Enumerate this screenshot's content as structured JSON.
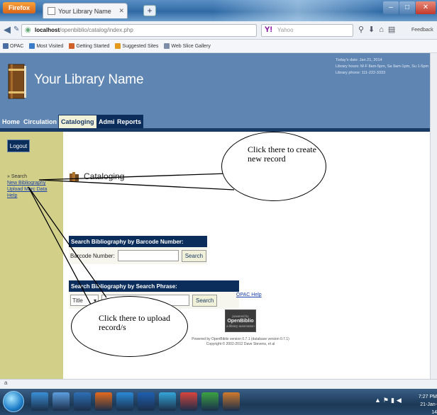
{
  "browser": {
    "menu_button": "Firefox",
    "tab_title": "Your Library Name",
    "url_host": "localhost",
    "url_path": "/openbiblio/catalog/index.php",
    "search_engine": "Yahoo",
    "feedback": "Feedback",
    "bookmarks": [
      {
        "label": "OPAC",
        "color": "#4a6fa5"
      },
      {
        "label": "Most Visited",
        "color": "#3b7cc9"
      },
      {
        "label": "Getting Started",
        "color": "#d0602a"
      },
      {
        "label": "Suggested Sites",
        "color": "#e39a1f"
      },
      {
        "label": "Web Slice Gallery",
        "color": "#7d8fa8"
      }
    ]
  },
  "header": {
    "library_name": "Your Library Name",
    "info_line1": "Today's date: Jan 21, 2014",
    "info_line2": "Library hours: M-F 8am-5pm, Sa 9am-1pm, Su 1-5pm",
    "info_line3": "Library phone: 111-222-3333"
  },
  "nav": {
    "home": "Home",
    "circulation": "Circulation",
    "cataloging": "Cataloging",
    "admin": "Admin",
    "reports": "Reports"
  },
  "sidebar": {
    "logout": "Logout",
    "search_label": "» Search",
    "new_bibliography": "New Bibliography",
    "upload_marc": "Upload Marc Data",
    "help": "Help"
  },
  "main": {
    "page_title": "Cataloging",
    "barcode_box_title": "Search Bibliography by Barcode Number:",
    "barcode_label": "Barcode Number:",
    "barcode_value": "",
    "phrase_box_title": "Search Bibliography by Search Phrase:",
    "phrase_select": "Title",
    "phrase_value": "",
    "search_button": "Search",
    "help_link": "OPAC Help",
    "powered_top": "powered by",
    "powered_brand": "OpenBiblio",
    "powered_bottom": "a library automation",
    "footer_line1": "Powered by OpenBiblio version 0.7.1 (database version 0.7.1)",
    "footer_line2": "Copyright © 2002-2012 Dave Stevens, et al"
  },
  "callouts": {
    "new_record": "Click there to create new record",
    "upload": "Click there to upload record/s"
  },
  "status": {
    "text": "a"
  },
  "taskbar": {
    "clock_time": "7:27 PM",
    "clock_date": "21-Jan-14",
    "icon_colors": [
      "#3a8fd6",
      "#5d9ee0",
      "#2f6fb7",
      "#e46a1e",
      "#2a89d8",
      "#1f5fb0",
      "#35a6d8",
      "#d9443c",
      "#3ca342",
      "#d07a2c"
    ]
  }
}
